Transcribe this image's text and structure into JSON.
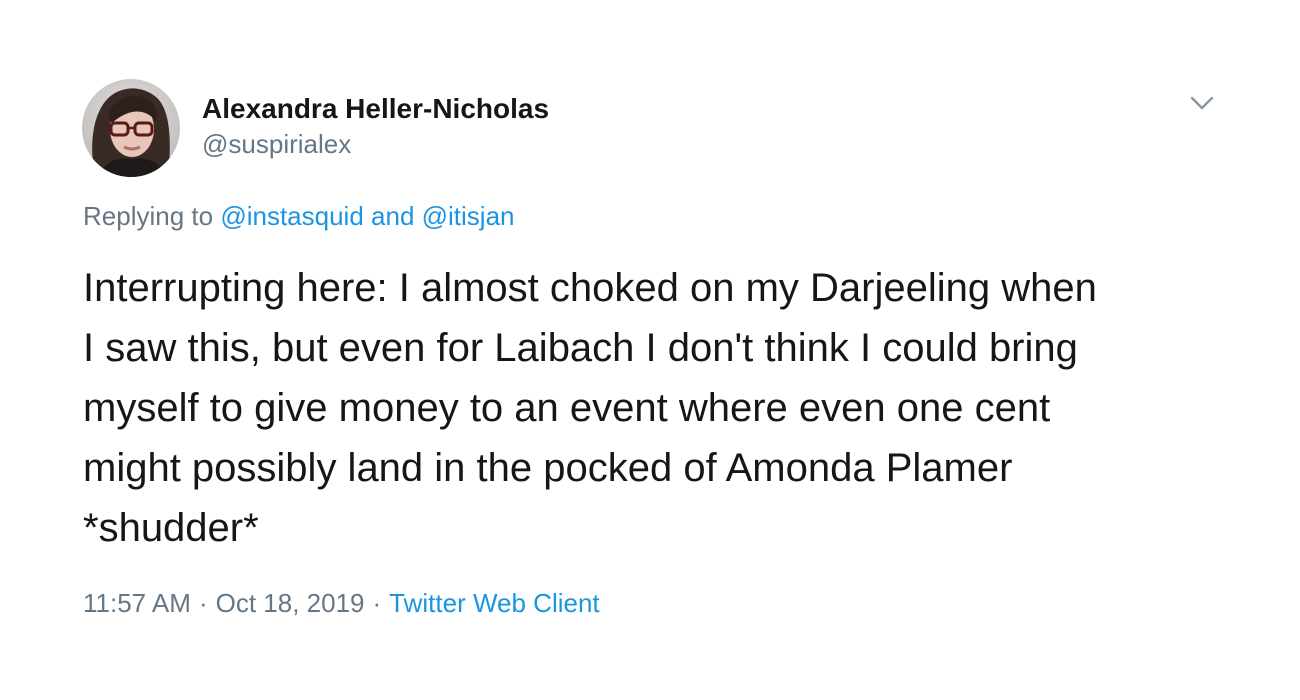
{
  "author": {
    "display_name": "Alexandra Heller-Nicholas",
    "handle": "@suspirialex"
  },
  "reply": {
    "prefix": "Replying to ",
    "user1": "@instasquid",
    "conjunction": " and ",
    "user2": "@itisjan"
  },
  "tweet": {
    "text": "Interrupting here: I almost choked on my Darjeeling when\nI saw this, but even for Laibach I don't think I could bring\nmyself to give money to an event where even one cent\nmight possibly land in the pocked of Amonda Plamer\n*shudder*"
  },
  "meta": {
    "time": "11:57 AM",
    "separator": "·",
    "date": "Oct 18, 2019",
    "source": "Twitter Web Client"
  },
  "icons": {
    "menu": "chevron-down-icon",
    "avatar": "avatar-photo"
  },
  "colors": {
    "link": "#1b95e0",
    "secondary_text": "#657786",
    "primary_text": "#14171a"
  }
}
